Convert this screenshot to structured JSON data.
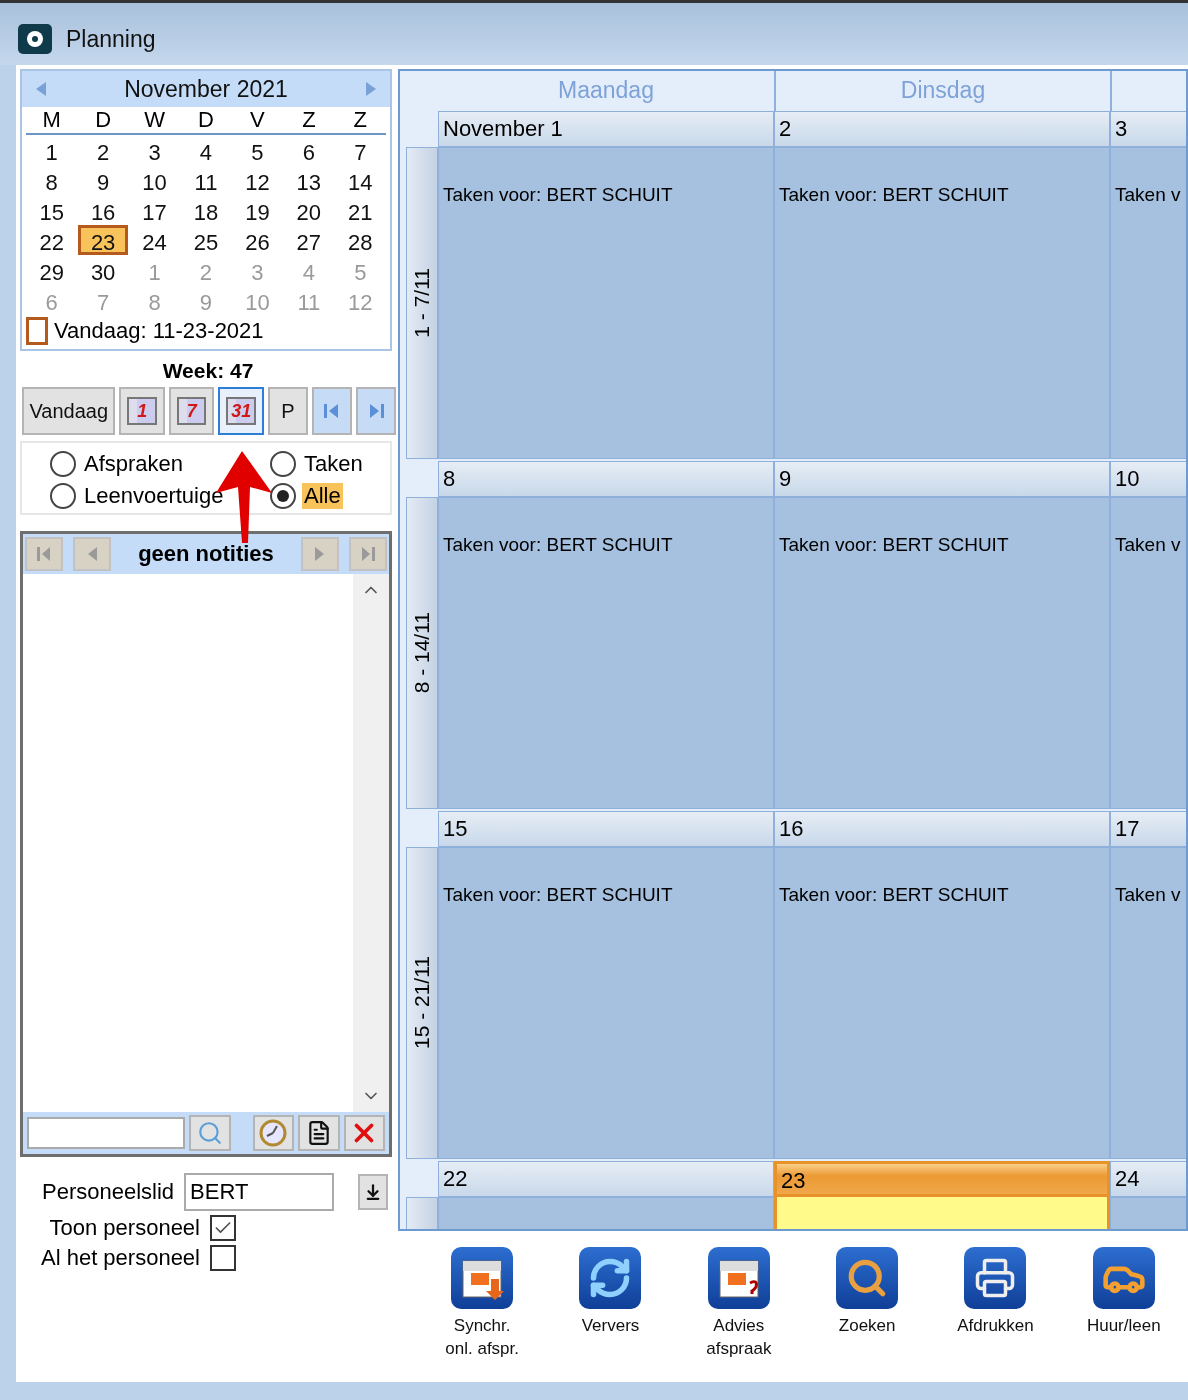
{
  "window": {
    "title": "Planning"
  },
  "mini_calendar": {
    "month": "November 2021",
    "weekdays": [
      "M",
      "D",
      "W",
      "D",
      "V",
      "Z",
      "Z"
    ],
    "days": [
      {
        "day": "1",
        "other_month": false,
        "selected": false
      },
      {
        "day": "2",
        "other_month": false,
        "selected": false
      },
      {
        "day": "3",
        "other_month": false,
        "selected": false
      },
      {
        "day": "4",
        "other_month": false,
        "selected": false
      },
      {
        "day": "5",
        "other_month": false,
        "selected": false
      },
      {
        "day": "6",
        "other_month": false,
        "selected": false
      },
      {
        "day": "7",
        "other_month": false,
        "selected": false
      },
      {
        "day": "8",
        "other_month": false,
        "selected": false
      },
      {
        "day": "9",
        "other_month": false,
        "selected": false
      },
      {
        "day": "10",
        "other_month": false,
        "selected": false
      },
      {
        "day": "11",
        "other_month": false,
        "selected": false
      },
      {
        "day": "12",
        "other_month": false,
        "selected": false
      },
      {
        "day": "13",
        "other_month": false,
        "selected": false
      },
      {
        "day": "14",
        "other_month": false,
        "selected": false
      },
      {
        "day": "15",
        "other_month": false,
        "selected": false
      },
      {
        "day": "16",
        "other_month": false,
        "selected": false
      },
      {
        "day": "17",
        "other_month": false,
        "selected": false
      },
      {
        "day": "18",
        "other_month": false,
        "selected": false
      },
      {
        "day": "19",
        "other_month": false,
        "selected": false
      },
      {
        "day": "20",
        "other_month": false,
        "selected": false
      },
      {
        "day": "21",
        "other_month": false,
        "selected": false
      },
      {
        "day": "22",
        "other_month": false,
        "selected": false
      },
      {
        "day": "23",
        "other_month": false,
        "selected": true
      },
      {
        "day": "24",
        "other_month": false,
        "selected": false
      },
      {
        "day": "25",
        "other_month": false,
        "selected": false
      },
      {
        "day": "26",
        "other_month": false,
        "selected": false
      },
      {
        "day": "27",
        "other_month": false,
        "selected": false
      },
      {
        "day": "28",
        "other_month": false,
        "selected": false
      },
      {
        "day": "29",
        "other_month": false,
        "selected": false
      },
      {
        "day": "30",
        "other_month": false,
        "selected": false
      },
      {
        "day": "1",
        "other_month": true,
        "selected": false
      },
      {
        "day": "2",
        "other_month": true,
        "selected": false
      },
      {
        "day": "3",
        "other_month": true,
        "selected": false
      },
      {
        "day": "4",
        "other_month": true,
        "selected": false
      },
      {
        "day": "5",
        "other_month": true,
        "selected": false
      },
      {
        "day": "6",
        "other_month": true,
        "selected": false
      },
      {
        "day": "7",
        "other_month": true,
        "selected": false
      },
      {
        "day": "8",
        "other_month": true,
        "selected": false
      },
      {
        "day": "9",
        "other_month": true,
        "selected": false
      },
      {
        "day": "10",
        "other_month": true,
        "selected": false
      },
      {
        "day": "11",
        "other_month": true,
        "selected": false
      },
      {
        "day": "12",
        "other_month": true,
        "selected": false
      }
    ],
    "today": "Vandaag: 11-23-2021"
  },
  "week": "Week: 47",
  "view_buttons": [
    {
      "kind": "text",
      "label": "Vandaag",
      "selected": false
    },
    {
      "kind": "calendar",
      "label": "1",
      "selected": false
    },
    {
      "kind": "calendar",
      "label": "7",
      "selected": false
    },
    {
      "kind": "calendar",
      "label": "31",
      "selected": true
    },
    {
      "kind": "text",
      "label": "P",
      "selected": false
    },
    {
      "kind": "prev",
      "selected": false
    },
    {
      "kind": "next",
      "selected": false
    }
  ],
  "filters": [
    {
      "label": "Afspraken",
      "selected": false
    },
    {
      "label": "Taken",
      "selected": false
    },
    {
      "label": "Leenvoertuige",
      "selected": false
    },
    {
      "label": "Alle",
      "selected": true
    }
  ],
  "notes": {
    "title": "geen notities"
  },
  "staff": {
    "label": "Personeelslid",
    "value": "BERT"
  },
  "checkboxes": [
    {
      "label": "Toon personeel",
      "checked": true
    },
    {
      "label": "Al het personeel",
      "checked": false
    }
  ],
  "planner": {
    "day_headers": [
      "Maandag",
      "Dinsdag"
    ],
    "weeks": [
      {
        "label": "1 - 7/11",
        "days": [
          {
            "date": "November 1",
            "text": "Taken voor: BERT SCHUIT",
            "today": false
          },
          {
            "date": "2",
            "text": "Taken voor: BERT SCHUIT",
            "today": false
          },
          {
            "date": "3",
            "text": "Taken v",
            "today": false
          }
        ]
      },
      {
        "label": "8 - 14/11",
        "days": [
          {
            "date": "8",
            "text": "Taken voor: BERT SCHUIT",
            "today": false
          },
          {
            "date": "9",
            "text": "Taken voor: BERT SCHUIT",
            "today": false
          },
          {
            "date": "10",
            "text": "Taken v",
            "today": false
          }
        ]
      },
      {
        "label": "15 - 21/11",
        "days": [
          {
            "date": "15",
            "text": "Taken voor: BERT SCHUIT",
            "today": false
          },
          {
            "date": "16",
            "text": "Taken voor: BERT SCHUIT",
            "today": false
          },
          {
            "date": "17",
            "text": "Taken v",
            "today": false
          }
        ]
      },
      {
        "days": [
          {
            "date": "22",
            "today": false
          },
          {
            "date": "23",
            "today": true
          },
          {
            "date": "24",
            "today": false
          }
        ]
      }
    ]
  },
  "toolbar": [
    {
      "kind": "sync",
      "label": "Synchr.\nonl. afspr."
    },
    {
      "kind": "refresh",
      "label": "Ververs"
    },
    {
      "kind": "advice",
      "label": "Advies\nafspraak"
    },
    {
      "kind": "search",
      "label": "Zoeken"
    },
    {
      "kind": "print",
      "label": "Afdrukken"
    },
    {
      "kind": "cars",
      "label": "Huur/leen"
    }
  ]
}
